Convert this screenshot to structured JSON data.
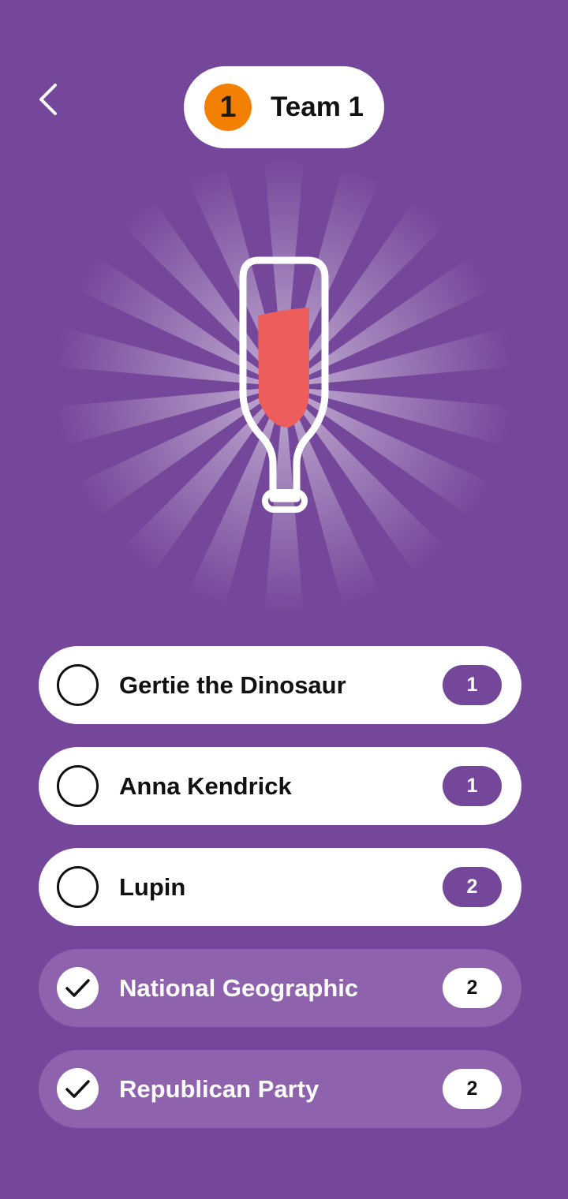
{
  "colors": {
    "background": "#75479a",
    "badge": "#f48003",
    "liquid": "#ec5d5b",
    "faded_row": "#8e62ad"
  },
  "header": {
    "back_icon": "chevron-left-icon",
    "team_number": "1",
    "team_name": "Team 1"
  },
  "hero": {
    "icon": "bottle-icon",
    "fill_level": 0.6
  },
  "options": [
    {
      "label": "Gertie the Dinosaur",
      "count": "1",
      "checked": false
    },
    {
      "label": "Anna Kendrick",
      "count": "1",
      "checked": false
    },
    {
      "label": "Lupin",
      "count": "2",
      "checked": false
    },
    {
      "label": "National Geographic",
      "count": "2",
      "checked": true
    },
    {
      "label": "Republican Party",
      "count": "2",
      "checked": true
    }
  ]
}
